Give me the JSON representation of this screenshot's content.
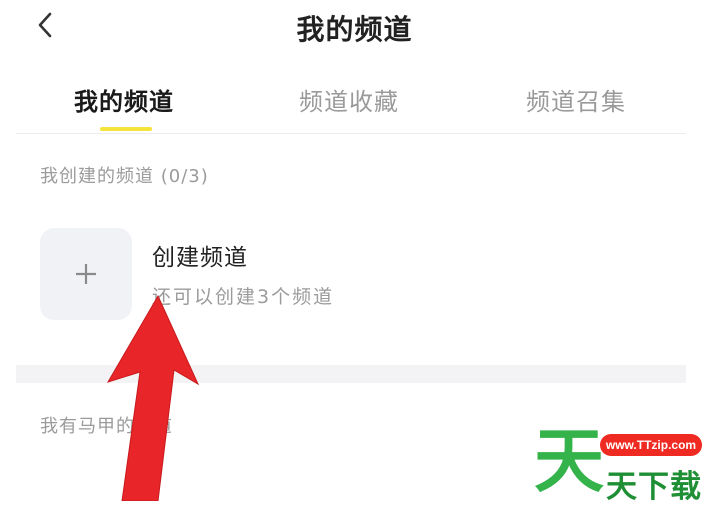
{
  "header": {
    "title": "我的频道",
    "back_icon": "chevron-left-icon"
  },
  "tabs": [
    {
      "label": "我的频道",
      "active": true
    },
    {
      "label": "频道收藏",
      "active": false
    },
    {
      "label": "频道召集",
      "active": false
    }
  ],
  "accent_color": "#f4e33a",
  "my_created": {
    "label": "我创建的频道 (0/3)",
    "create_title": "创建频道",
    "create_subtitle": "还可以创建3个频道",
    "plus_icon": "plus-icon"
  },
  "alt_section": {
    "label": "我有马甲的频道"
  },
  "overlay": {
    "arrow_icon": "red-arrow-icon",
    "arrow_color": "#e8262a"
  },
  "watermark": {
    "url": "www.TTzip.com",
    "big_char": "天",
    "text": "天下载",
    "color": "#33b34a"
  }
}
